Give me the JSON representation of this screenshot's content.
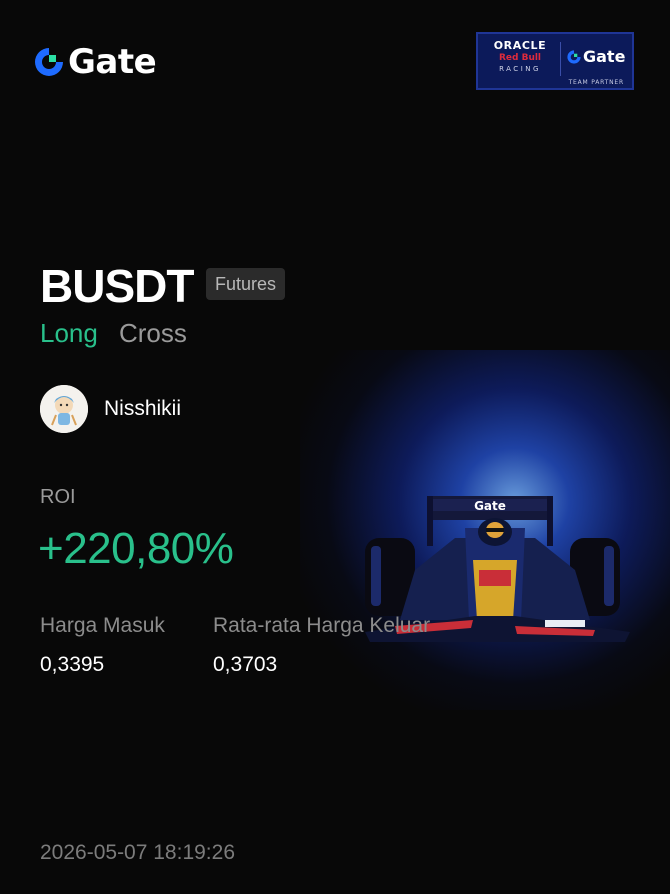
{
  "brand": {
    "logo_text": "Gate"
  },
  "partner": {
    "oracle": "ORACLE",
    "red_bull": "Red Bull",
    "racing": "RACING",
    "gate": "Gate",
    "team_partner": "TEAM PARTNER"
  },
  "position": {
    "pair": "BUSDT",
    "contract_type": "Futures",
    "side": "Long",
    "margin_mode": "Cross"
  },
  "user": {
    "name": "Nisshikii"
  },
  "roi": {
    "label": "ROI",
    "value": "+220,80%"
  },
  "prices": {
    "entry_label": "Harga Masuk",
    "entry_value": "0,3395",
    "exit_label": "Rata-rata Harga Keluar",
    "exit_value": "0,3703"
  },
  "timestamp": "2026-05-07 18:19:26",
  "colors": {
    "background": "#080808",
    "positive": "#29c08b",
    "brand_blue": "#1e6bff",
    "muted": "#9a9a9a"
  },
  "icons": [
    "gate-logo-icon",
    "avatar",
    "f1-car-image"
  ]
}
